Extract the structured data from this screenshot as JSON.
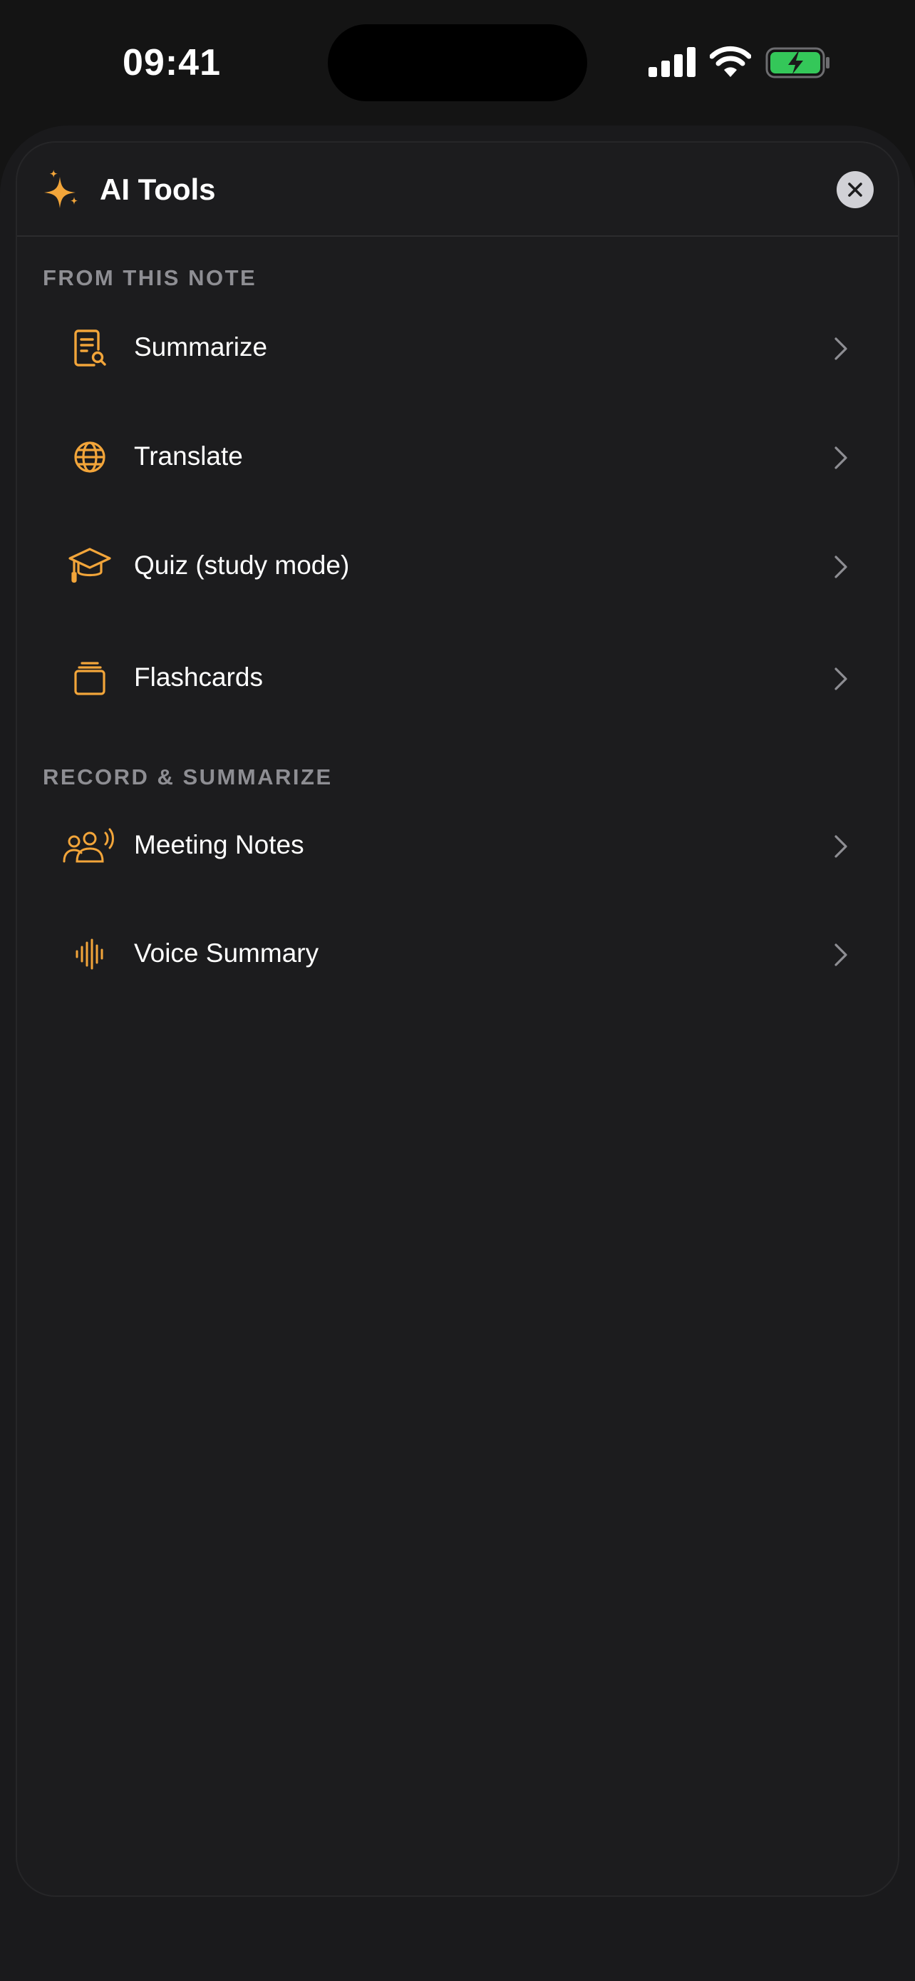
{
  "status_bar": {
    "time": "09:41"
  },
  "sheet": {
    "title": "AI Tools",
    "title_icon": "sparkles-icon",
    "accent_color": "#f2a53a",
    "sections": [
      {
        "label": "FROM THIS NOTE",
        "items": [
          {
            "label": "Summarize",
            "icon": "document-search-icon"
          },
          {
            "label": "Translate",
            "icon": "globe-icon"
          },
          {
            "label": "Quiz (study mode)",
            "icon": "graduation-cap-icon"
          },
          {
            "label": "Flashcards",
            "icon": "flashcards-icon"
          }
        ]
      },
      {
        "label": "RECORD & SUMMARIZE",
        "items": [
          {
            "label": "Meeting Notes",
            "icon": "people-speaking-icon"
          },
          {
            "label": "Voice Summary",
            "icon": "waveform-icon"
          }
        ]
      }
    ]
  }
}
